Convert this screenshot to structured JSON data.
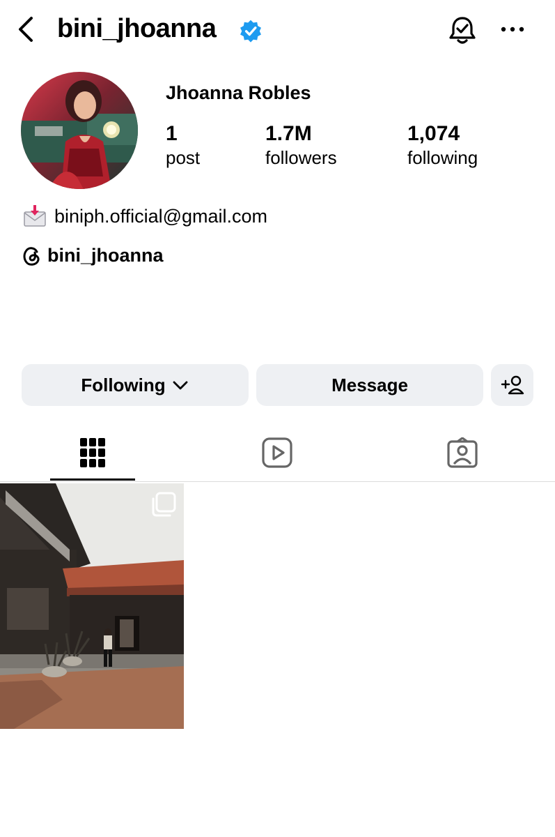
{
  "header": {
    "username": "bini_jhoanna",
    "verified_icon": "verified-badge-icon",
    "verified_color": "#0095f6"
  },
  "profile": {
    "full_name": "Jhoanna Robles",
    "stats": {
      "posts": {
        "value": "1",
        "label": "post"
      },
      "followers": {
        "value": "1.7M",
        "label": "followers"
      },
      "following": {
        "value": "1,074",
        "label": "following"
      }
    },
    "email": "biniph.official@gmail.com",
    "threads_handle": "bini_jhoanna"
  },
  "actions": {
    "following_label": "Following",
    "message_label": "Message"
  },
  "tabs": [
    {
      "name": "posts-grid",
      "icon": "grid-icon",
      "active": true
    },
    {
      "name": "reels",
      "icon": "reels-icon",
      "active": false
    },
    {
      "name": "tagged",
      "icon": "tagged-icon",
      "active": false
    }
  ],
  "posts": [
    {
      "type": "carousel",
      "icon": "multiple-photos-icon"
    }
  ]
}
